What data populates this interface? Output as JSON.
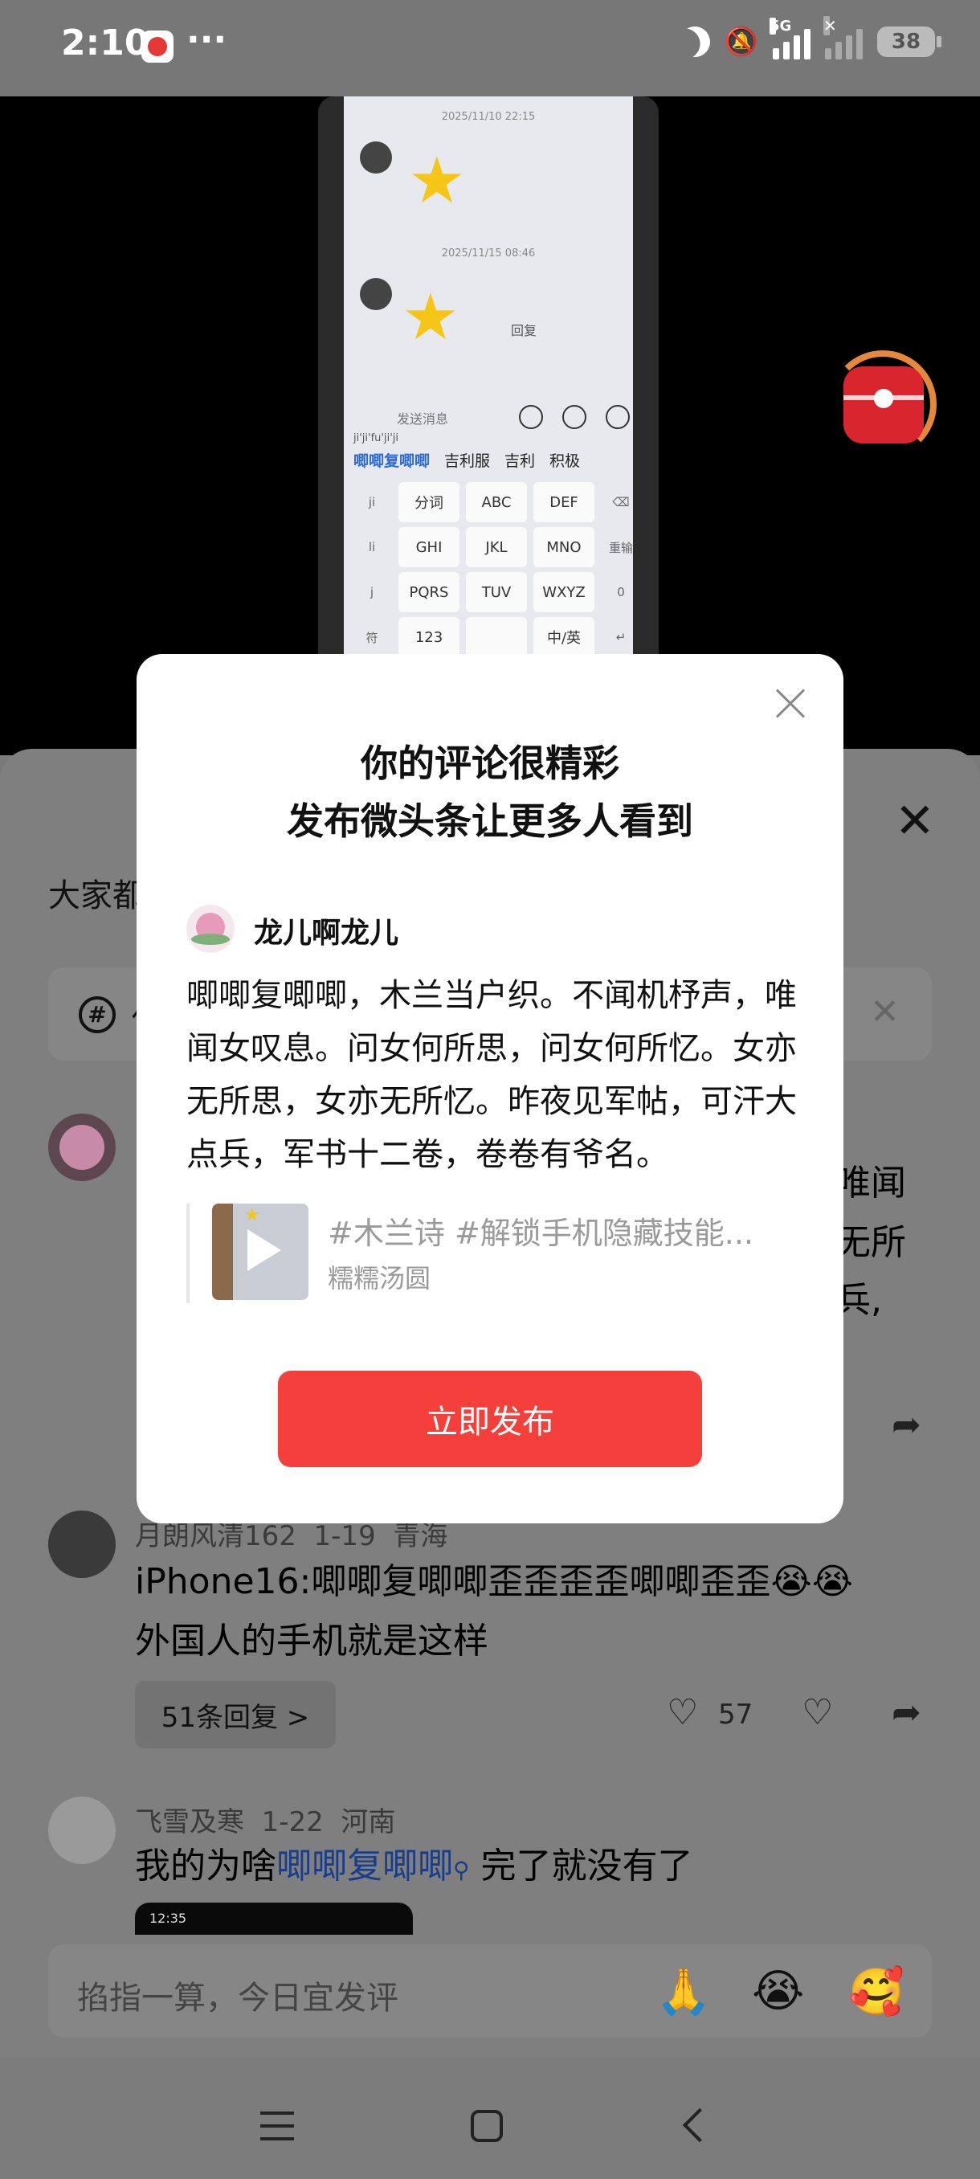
{
  "status_bar": {
    "time": "2:10",
    "more": "···",
    "network": "5G",
    "battery": "38"
  },
  "video": {
    "timestamps": [
      "2025/11/10 22:15",
      "2025/11/15 08:46"
    ],
    "reply_label": "回复",
    "input_placeholder": "发送消息",
    "pinyin": "ji'ji'fu'ji'ji",
    "candidates": [
      "唧唧复唧唧",
      "吉利服",
      "吉利",
      "积极"
    ],
    "keys": [
      "ji",
      "分词",
      "ABC",
      "DEF",
      "⌫",
      "li",
      "GHI",
      "JKL",
      "MNO",
      "重输",
      "j",
      "PQRS",
      "TUV",
      "WXYZ",
      "0",
      "符",
      "123",
      "",
      "中/英",
      "↵"
    ]
  },
  "sheet": {
    "title": "大家都",
    "search_prefix": "你"
  },
  "comments": [
    {
      "partial_lines": [
        "唯闻",
        "无所",
        "兵,"
      ]
    },
    {
      "user": "月朗风清162",
      "date": "1-19",
      "location": "青海",
      "line1": "iPhone16:唧唧复唧唧歪歪歪歪唧唧歪歪😭😭",
      "line2": "外国人的手机就是这样",
      "replies": "51条回复 >",
      "likes": "57"
    },
    {
      "user": "飞雪及寒",
      "date": "1-22",
      "location": "河南",
      "text_before": "我的为啥",
      "link": "唧唧复唧唧",
      "text_after": "完了就没有了",
      "thumb_time": "12:35"
    }
  ],
  "comment_input": {
    "placeholder": "掐指一算，今日宜发评",
    "emojis": [
      "🙏",
      "😭",
      "🥰"
    ]
  },
  "modal": {
    "title_line1": "你的评论很精彩",
    "title_line2": "发布微头条让更多人看到",
    "username": "龙儿啊龙儿",
    "body": "唧唧复唧唧，木兰当户织。不闻机杼声，唯闻女叹息。问女何所思，问女何所忆。女亦无所思，女亦无所忆。昨夜见军帖，可汗大点兵，军书十二卷，卷卷有爷名。",
    "quote_tags": "#木兰诗 #解锁手机隐藏技能...",
    "quote_author": "糯糯汤圆",
    "publish_button": "立即发布"
  },
  "colors": {
    "accent": "#f43f3a",
    "link": "#1a3d8a",
    "overlay": "#7f7f7f"
  }
}
